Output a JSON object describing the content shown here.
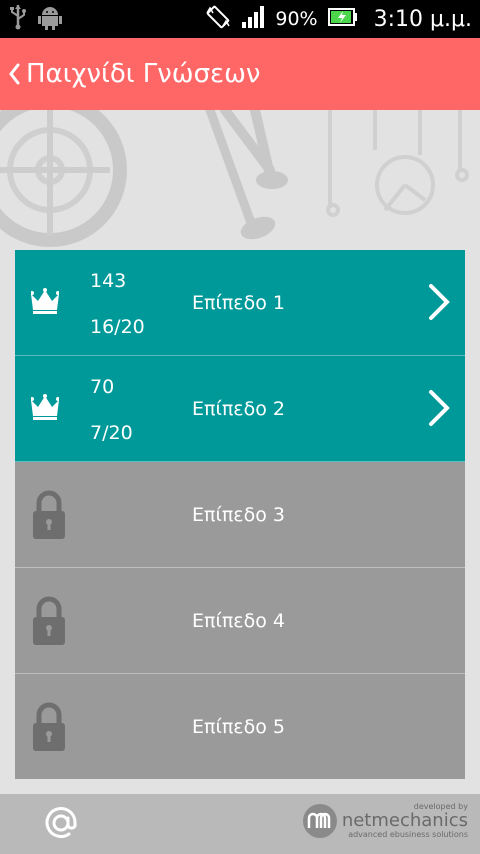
{
  "status_bar": {
    "battery": "90%",
    "time": "3:10 μ.μ."
  },
  "action_bar": {
    "title": "Παιχνίδι Γνώσεων"
  },
  "levels": [
    {
      "label": "Επίπεδο 1",
      "score": "143",
      "progress": "16/20",
      "state": "unlocked"
    },
    {
      "label": "Επίπεδο 2",
      "score": "70",
      "progress": "7/20",
      "state": "unlocked"
    },
    {
      "label": "Επίπεδο 3",
      "state": "locked"
    },
    {
      "label": "Επίπεδο 4",
      "state": "locked"
    },
    {
      "label": "Επίπεδο 5",
      "state": "locked"
    }
  ],
  "footer": {
    "brand_developed_by": "developed by",
    "brand_name": "netmechanics",
    "brand_tagline": "advanced ebusiness solutions"
  },
  "colors": {
    "action_bar": "#ff6767",
    "unlocked": "#00999a",
    "locked": "#9a9a9a"
  },
  "icons": [
    "usb-icon",
    "android-icon",
    "rotate-icon",
    "signal-icon",
    "battery-charging-icon",
    "back-chevron-icon",
    "crown-icon",
    "lock-icon",
    "chevron-right-icon",
    "at-icon",
    "netmechanics-logo-icon"
  ]
}
